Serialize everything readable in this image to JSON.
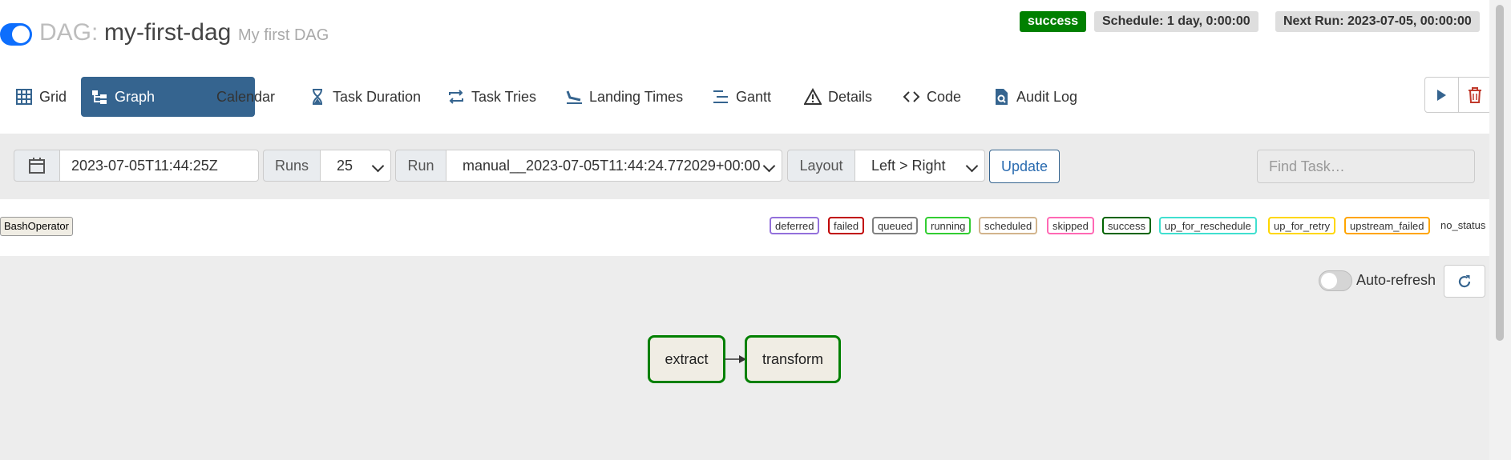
{
  "header": {
    "dag_prefix": "DAG:",
    "dag_id": "my-first-dag",
    "description": "My first DAG",
    "status": "success",
    "schedule": "Schedule: 1 day, 0:00:00",
    "next_run": "Next Run: 2023-07-05, 00:00:00"
  },
  "tabs": [
    {
      "label": "Grid",
      "icon": "grid-icon"
    },
    {
      "label": "Graph",
      "icon": "graph-icon"
    },
    {
      "label": "Calendar",
      "icon": "calendar-icon"
    },
    {
      "label": "Task Duration",
      "icon": "hourglass-icon"
    },
    {
      "label": "Task Tries",
      "icon": "repeat-icon"
    },
    {
      "label": "Landing Times",
      "icon": "plane-landing-icon"
    },
    {
      "label": "Gantt",
      "icon": "gantt-icon"
    },
    {
      "label": "Details",
      "icon": "warning-triangle-icon"
    },
    {
      "label": "Code",
      "icon": "code-icon"
    },
    {
      "label": "Audit Log",
      "icon": "file-search-icon"
    }
  ],
  "filters": {
    "base_date": "2023-07-05T11:44:25Z",
    "runs_label": "Runs",
    "runs_value": "25",
    "run_label": "Run",
    "run_value": "manual__2023-07-05T11:44:24.772029+00:00",
    "layout_label": "Layout",
    "layout_value": "Left > Right",
    "update_label": "Update",
    "find_placeholder": "Find Task…"
  },
  "operator_badge": "BashOperator",
  "legend": [
    {
      "label": "deferred",
      "color": "#9370db"
    },
    {
      "label": "failed",
      "color": "#c00000"
    },
    {
      "label": "queued",
      "color": "#808080"
    },
    {
      "label": "running",
      "color": "#32cd32"
    },
    {
      "label": "scheduled",
      "color": "#d2b48c"
    },
    {
      "label": "skipped",
      "color": "#ff69b4"
    },
    {
      "label": "success",
      "color": "#006400"
    },
    {
      "label": "up_for_reschedule",
      "color": "#40e0d0"
    },
    {
      "label": "up_for_retry",
      "color": "#ffd700"
    },
    {
      "label": "upstream_failed",
      "color": "#ffa500"
    },
    {
      "label": "no_status",
      "color": "#ffffff"
    }
  ],
  "graph": {
    "autorefresh_label": "Auto-refresh",
    "nodes": [
      {
        "label": "extract",
        "state": "success"
      },
      {
        "label": "transform",
        "state": "success"
      }
    ]
  },
  "colors": {
    "accent": "#35648f",
    "toggle_on": "#0d6efd",
    "success": "#008000",
    "delete": "#c0392b"
  }
}
